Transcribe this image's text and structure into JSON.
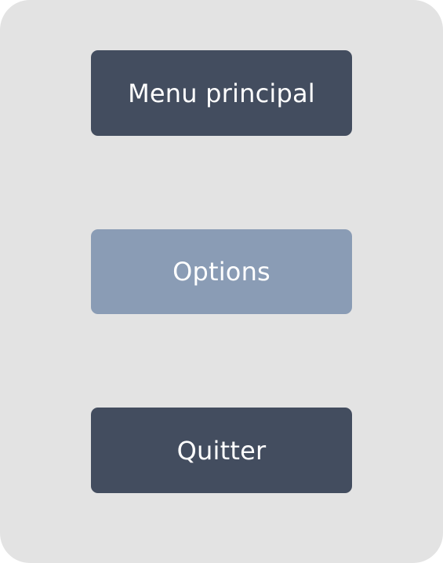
{
  "menu": {
    "buttons": [
      {
        "label": "Menu principal",
        "state": "normal",
        "color": "#434d5f"
      },
      {
        "label": "Options",
        "state": "highlighted",
        "color": "#8a9cb5"
      },
      {
        "label": "Quitter",
        "state": "normal",
        "color": "#434d5f"
      }
    ],
    "background_color": "#e3e3e3"
  }
}
